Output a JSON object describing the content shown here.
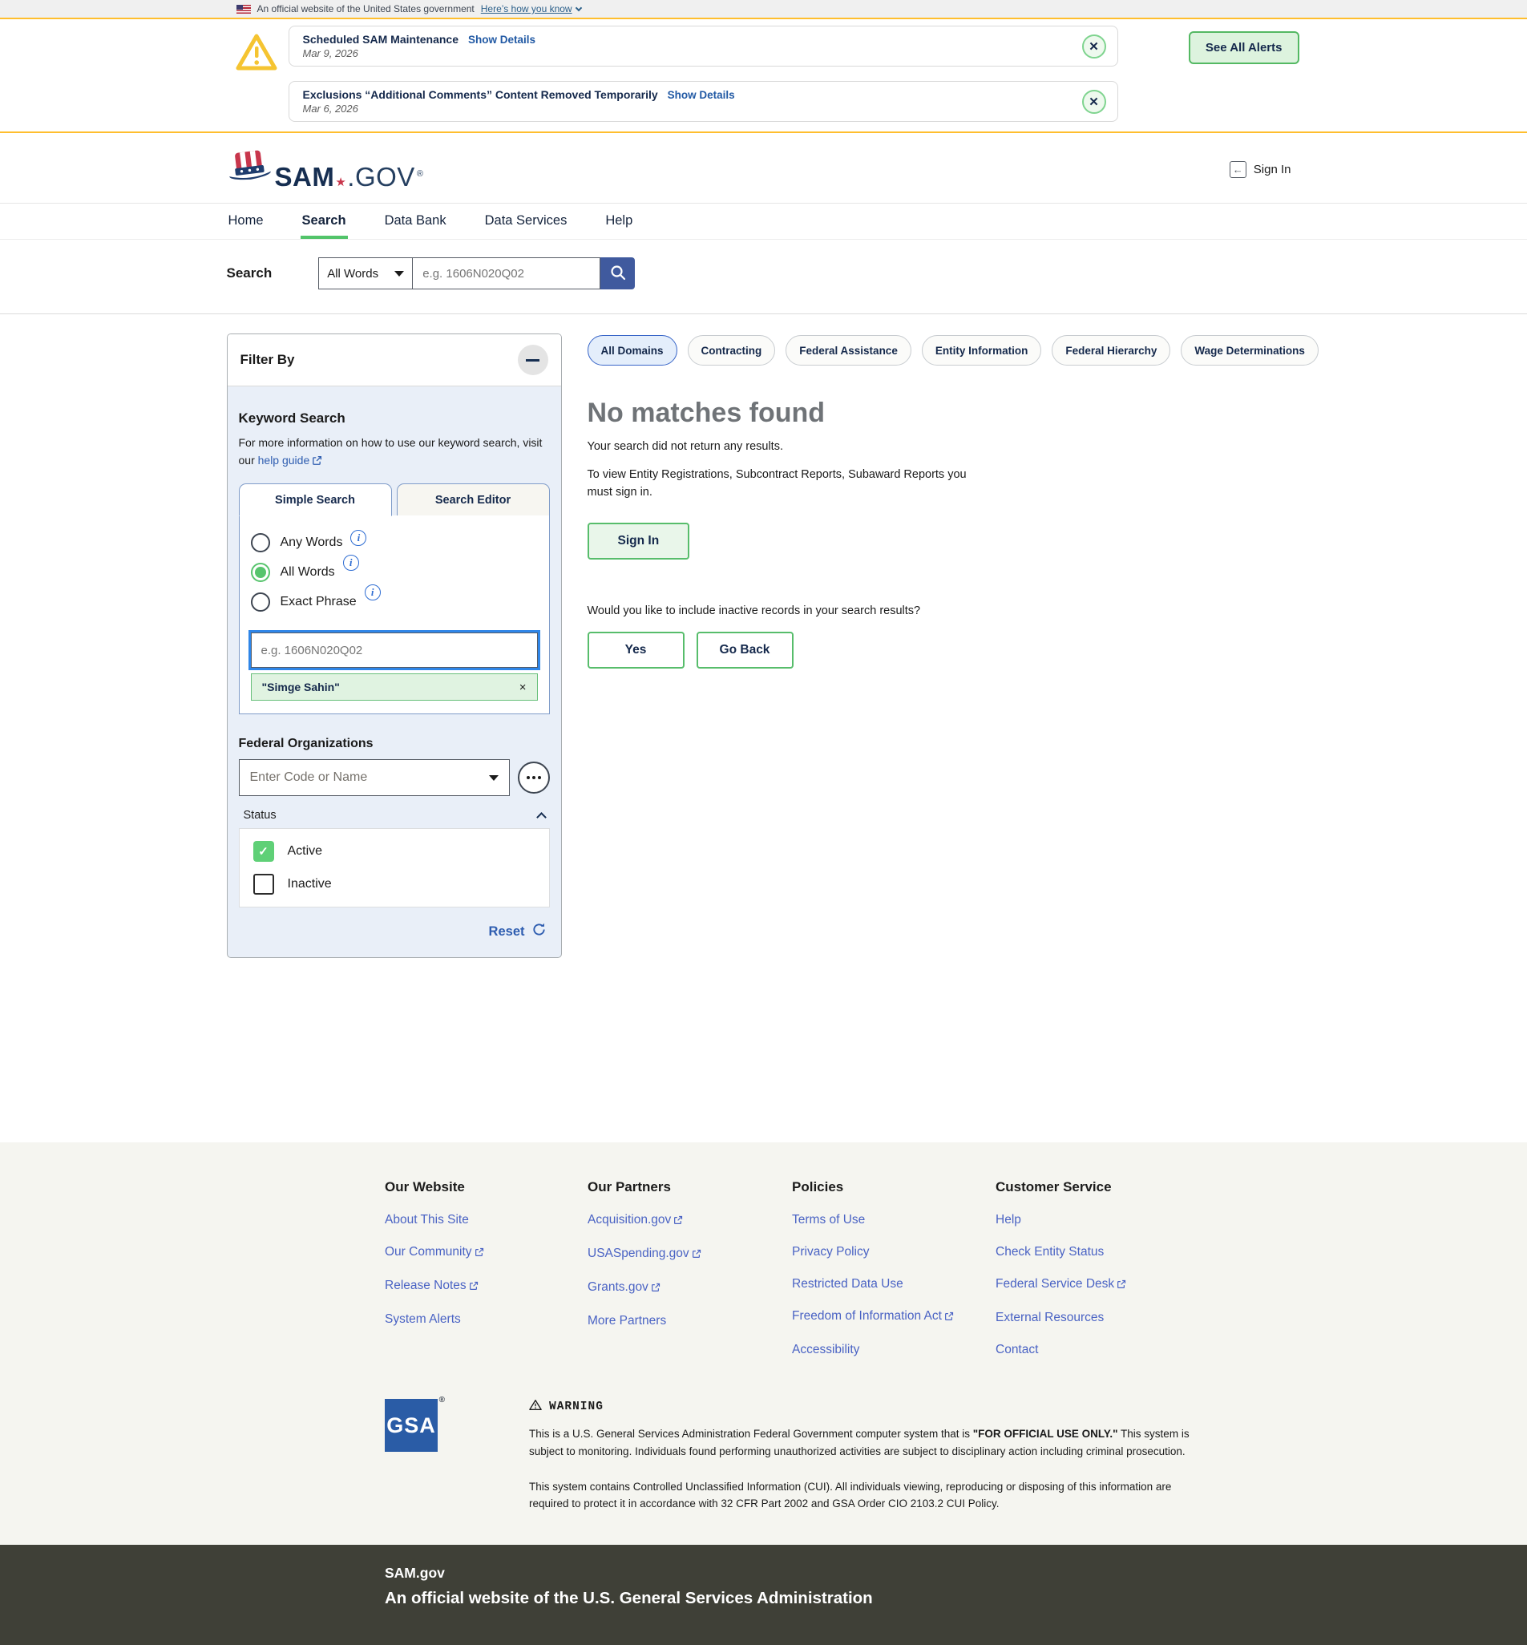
{
  "banner": {
    "text": "An official website of the United States government",
    "link": "Here’s how you know"
  },
  "alerts": {
    "items": [
      {
        "title": "Scheduled SAM Maintenance",
        "link": "Show Details",
        "date": "Mar 9, 2026",
        "close": "✕"
      },
      {
        "title": "Exclusions “Additional Comments” Content Removed Temporarily",
        "link": "Show Details",
        "date": "Mar 6, 2026",
        "close": "✕"
      }
    ],
    "see_all": "See All Alerts"
  },
  "header": {
    "logo_sam": "SAM",
    "logo_star": "★",
    "logo_gov": ".GOV",
    "logo_reg": "®",
    "sign_in": "Sign In",
    "sign_in_icon": "←"
  },
  "nav": {
    "items": [
      {
        "label": "Home"
      },
      {
        "label": "Search"
      },
      {
        "label": "Data Bank"
      },
      {
        "label": "Data Services"
      },
      {
        "label": "Help"
      }
    ]
  },
  "search_bar": {
    "label": "Search",
    "dropdown_value": "All Words",
    "placeholder": "e.g. 1606N020Q02"
  },
  "filter": {
    "title": "Filter By",
    "keyword_heading": "Keyword Search",
    "info_text": "For more information on how to use our keyword search, visit our",
    "help_link": "help guide",
    "tabs": [
      {
        "label": "Simple Search"
      },
      {
        "label": "Search Editor"
      }
    ],
    "radios": [
      {
        "label": "Any Words"
      },
      {
        "label": "All Words"
      },
      {
        "label": "Exact Phrase"
      }
    ],
    "input_placeholder": "e.g. 1606N020Q02",
    "chip_label": "\"Simge Sahin\"",
    "chip_remove": "×",
    "fedorg_heading": "Federal Organizations",
    "combo_placeholder": "Enter Code or Name",
    "status_label": "Status",
    "checkboxes": [
      {
        "label": "Active",
        "checked": true,
        "check_glyph": "✓"
      },
      {
        "label": "Inactive",
        "checked": false,
        "check_glyph": ""
      }
    ],
    "reset_label": "Reset"
  },
  "domains": {
    "items": [
      {
        "label": "All Domains"
      },
      {
        "label": "Contracting"
      },
      {
        "label": "Federal Assistance"
      },
      {
        "label": "Entity Information"
      },
      {
        "label": "Federal Hierarchy"
      },
      {
        "label": "Wage Determinations"
      }
    ]
  },
  "results": {
    "title": "No matches found",
    "line1": "Your search did not return any results.",
    "line2": "To view Entity Registrations, Subcontract Reports, Subaward Reports you must sign in.",
    "sign_in": "Sign In",
    "question": "Would you like to include inactive records in your search results?",
    "yes": "Yes",
    "go_back": "Go Back"
  },
  "footer": {
    "columns": [
      {
        "heading": "Our Website",
        "links": [
          {
            "label": "About This Site"
          },
          {
            "label": "Our Community"
          },
          {
            "label": "Release Notes"
          },
          {
            "label": "System Alerts"
          }
        ]
      },
      {
        "heading": "Our Partners",
        "links": [
          {
            "label": "Acquisition.gov"
          },
          {
            "label": "USASpending.gov"
          },
          {
            "label": "Grants.gov"
          },
          {
            "label": "More Partners"
          }
        ]
      },
      {
        "heading": "Policies",
        "links": [
          {
            "label": "Terms of Use"
          },
          {
            "label": "Privacy Policy"
          },
          {
            "label": "Restricted Data Use"
          },
          {
            "label": "Freedom of Information Act"
          },
          {
            "label": "Accessibility"
          }
        ]
      },
      {
        "heading": "Customer Service",
        "links": [
          {
            "label": "Help"
          },
          {
            "label": "Check Entity Status"
          },
          {
            "label": "Federal Service Desk"
          },
          {
            "label": "External Resources"
          },
          {
            "label": "Contact"
          }
        ]
      }
    ],
    "gsa_logo": "GSA",
    "gsa_reg": "®",
    "warning_title": "WARNING",
    "warning_p1_pre": "This is a U.S. General Services Administration Federal Government computer system that is ",
    "warning_p1_bold": "\"FOR OFFICIAL USE ONLY.\"",
    "warning_p1_post": " This system is subject to monitoring. Individuals found performing unauthorized activities are subject to disciplinary action including criminal prosecution.",
    "warning_p2": "This system contains Controlled Unclassified Information (CUI). All individuals viewing, reproducing or disposing of this information are required to protect it in accordance with 32 CFR Part 2002 and GSA Order CIO 2103.2 CUI Policy."
  },
  "bottom_bar": {
    "title": "SAM.gov",
    "subtitle": "An official website of the U.S. General Services Administration"
  },
  "colors": {
    "navy": "#162e51",
    "accent_green": "#52c46a",
    "gold": "#ffbe2e",
    "link_blue": "#2e5db0",
    "footer_link": "#4a63c4",
    "search_button_blue": "#405a9e",
    "gsa_blue": "#2a5ca6",
    "bottom_bar": "#3f4037"
  }
}
